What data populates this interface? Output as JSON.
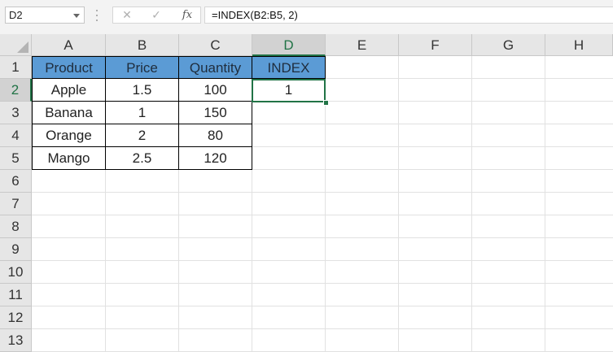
{
  "formula_bar": {
    "name_box": "D2",
    "formula": "=INDEX(B2:B5, 2)",
    "cancel_icon": "✕",
    "enter_icon": "✓",
    "fx_label": "fx"
  },
  "columns": [
    "A",
    "B",
    "C",
    "D",
    "E",
    "F",
    "G",
    "H"
  ],
  "rows": [
    "1",
    "2",
    "3",
    "4",
    "5",
    "6",
    "7",
    "8",
    "9",
    "10",
    "11",
    "12",
    "13"
  ],
  "selected_cell": "D2",
  "table": {
    "header_color": "#5b9bd5",
    "headers": [
      "Product",
      "Price",
      "Quantity",
      "INDEX"
    ],
    "body": [
      [
        "Apple",
        "1.5",
        "100",
        "1"
      ],
      [
        "Banana",
        "1",
        "150"
      ],
      [
        "Orange",
        "2",
        "80"
      ],
      [
        "Mango",
        "2.5",
        "120"
      ]
    ]
  },
  "accent_color": "#217346"
}
